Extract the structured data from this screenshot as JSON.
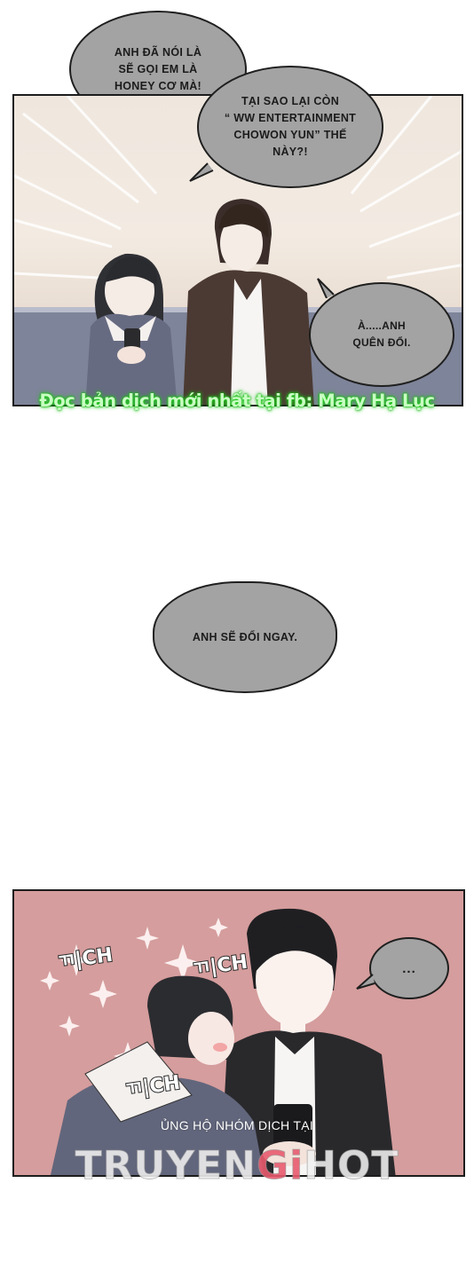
{
  "bubbles": {
    "b1": "ANH ĐÃ NÓI LÀ\nSẼ GỌI EM LÀ\nHONEY CƠ MÀ!",
    "b2": "TẠI SAO LẠI CÒN\n“ WW ENTERTAINMENT\nCHOWON YUN” THẾ\nNÀY?!",
    "b3": "À.....ANH\nQUÊN ĐỔI.",
    "b4": "ANH SẼ ĐỔI NGAY.",
    "b5": "..."
  },
  "watermark": {
    "fb_text": "Đọc bản dịch mới nhất tại fb: Mary Hạ Lục",
    "support_text": "ỦNG HỘ NHÓM DỊCH TẠI",
    "brand_left": "TRUYEN",
    "brand_mid": "Gi",
    "brand_right": "HOT"
  },
  "sfx": [
    "ㄲ|CH",
    "ㄲ|CH",
    "ㄲ|CH"
  ],
  "colors": {
    "bubble_fill": "#a3a3a3",
    "panel2_bg": "#d59d9d",
    "fb_glow": "#21d21e"
  }
}
